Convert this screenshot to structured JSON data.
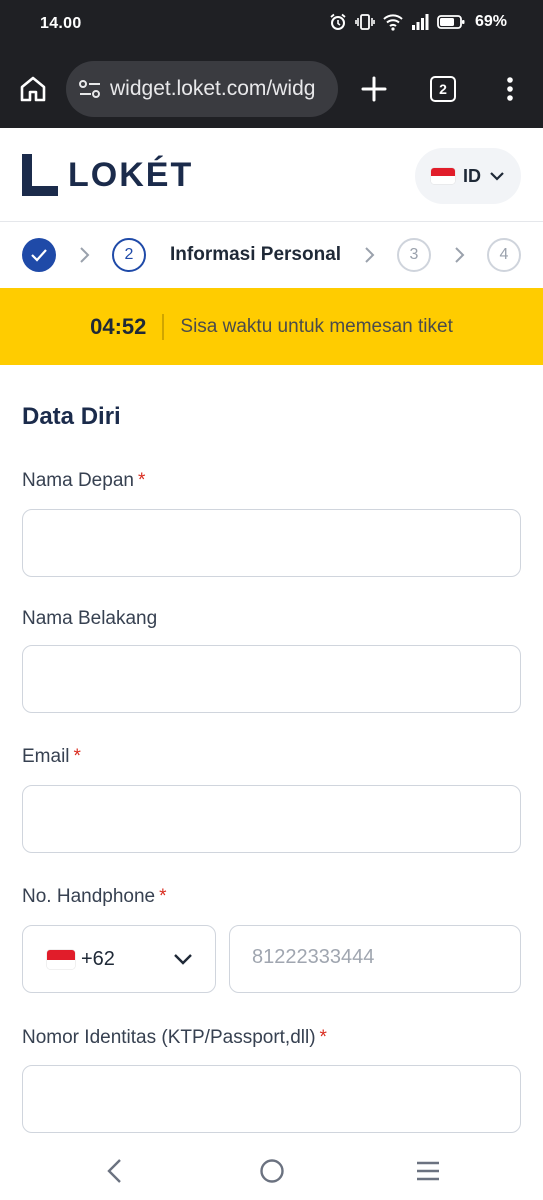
{
  "status_bar": {
    "time": "14.00",
    "battery": "69%"
  },
  "browser": {
    "url": "widget.loket.com/widg",
    "tab_count": "2"
  },
  "header": {
    "brand": "LOKÉT",
    "language": "ID"
  },
  "stepper": {
    "active_number": "2",
    "active_label": "Informasi Personal",
    "next_steps": [
      "3",
      "4"
    ]
  },
  "timer": {
    "time": "04:52",
    "message": "Sisa waktu untuk memesan tiket"
  },
  "form": {
    "section_title": "Data Diri",
    "first_name_label": "Nama Depan",
    "last_name_label": "Nama Belakang",
    "email_label": "Email",
    "phone_label": "No. Handphone",
    "phone_code": "+62",
    "phone_placeholder": "81222333444",
    "id_label": "Nomor Identitas (KTP/Passport,dll)",
    "required_mark": "*"
  },
  "colors": {
    "brand_navy": "#1b2b4b",
    "primary_blue": "#1f4aa8",
    "timer_yellow": "#ffcc00",
    "required_red": "#d92d20"
  }
}
